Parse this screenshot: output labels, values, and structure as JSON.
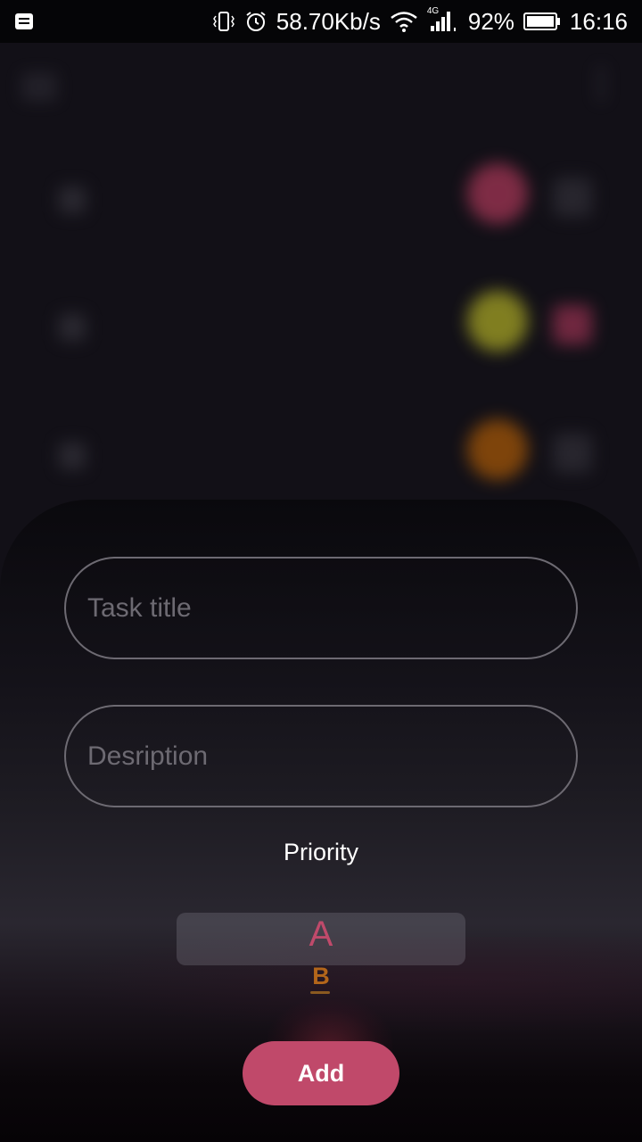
{
  "status_bar": {
    "speed": "58.70Kb/s",
    "network": "4G",
    "battery_percent": "92%",
    "time": "16:16"
  },
  "form": {
    "title_placeholder": "Task title",
    "description_placeholder": "Desription",
    "title_value": "",
    "description_value": ""
  },
  "priority": {
    "label": "Priority",
    "options": [
      "A",
      "B"
    ],
    "selected": "A"
  },
  "add_button_label": "Add",
  "colors": {
    "accent": "#c0496a",
    "priority_a": "#c04a6b",
    "priority_b": "#b3661a",
    "field_border": "#6d6a72"
  }
}
